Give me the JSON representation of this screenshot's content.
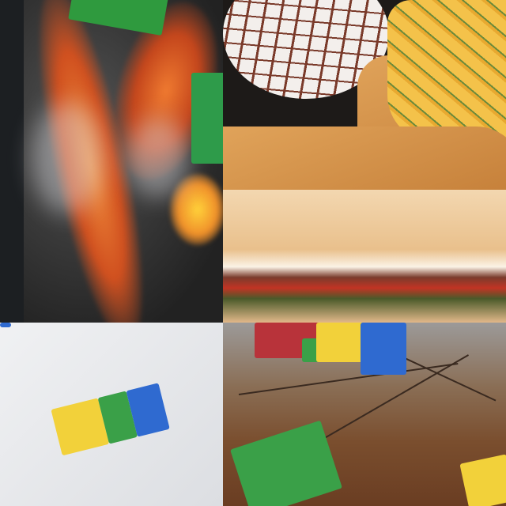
{
  "palette": {
    "lava_orange": "#e8662a",
    "rock_gray": "#3a3a3a",
    "lego_green": "#2f9a3e",
    "lego_yellow": "#f2d13a",
    "lego_blue": "#2f6ad0",
    "lego_red": "#b8333a",
    "board_wood": "#d8984c",
    "background_white": "#eceef0"
  }
}
